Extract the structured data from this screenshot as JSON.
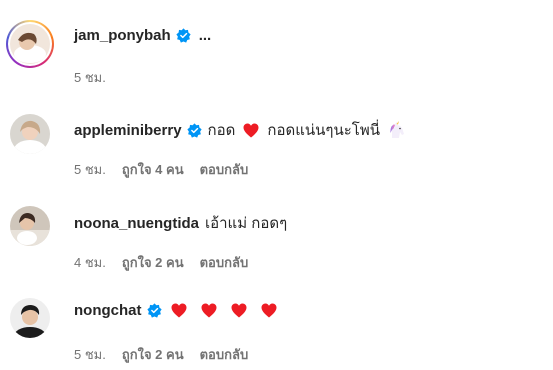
{
  "comments": [
    {
      "username": "jam_ponybah",
      "verified": true,
      "text": "...",
      "time": "5 ชม.",
      "likes": "",
      "reply_label": ""
    },
    {
      "username": "appleminiberry",
      "verified": true,
      "text_before_heart": "กอด",
      "text_after_heart": "กอดแน่นๆนะโพนี่",
      "time": "5 ชม.",
      "likes": "ถูกใจ 4 คน",
      "reply_label": "ตอบกลับ"
    },
    {
      "username": "noona_nuengtida",
      "verified": false,
      "text": "เอ้าแม่ กอดๆ",
      "time": "4 ชม.",
      "likes": "ถูกใจ 2 คน",
      "reply_label": "ตอบกลับ"
    },
    {
      "username": "nongchat",
      "verified": true,
      "hearts_count": 4,
      "time": "5 ชม.",
      "likes": "ถูกใจ 2 คน",
      "reply_label": "ตอบกลับ"
    }
  ],
  "colors": {
    "verified_blue": "#0095f6",
    "heart_red": "#ed1c24",
    "muted_text": "#737373"
  }
}
